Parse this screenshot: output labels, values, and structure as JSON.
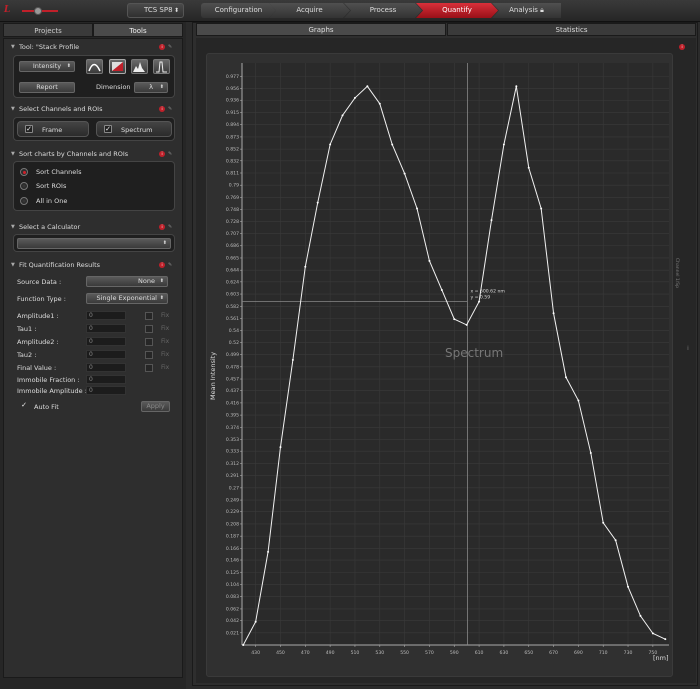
{
  "header": {
    "system_name": "TCS SP8",
    "workflow": [
      "Configuration",
      "Acquire",
      "Process",
      "Quantify",
      "Analysis"
    ],
    "active_step": "Quantify"
  },
  "left_panel": {
    "tabs": [
      "Projects",
      "Tools"
    ],
    "active_tab": "Tools",
    "tool_section": {
      "title": "Tool: \"Stack Profile",
      "mode_select": "Intensity",
      "report_button": "Report",
      "dimension_label": "Dimension",
      "dimension_value": "λ"
    },
    "channels_section": {
      "title": "Select Channels and ROIs",
      "frame_label": "Frame",
      "spectrum_label": "Spectrum"
    },
    "sort_section": {
      "title": "Sort charts by Channels and ROIs",
      "options": [
        "Sort Channels",
        "Sort ROIs",
        "All in One"
      ],
      "selected": "Sort Channels"
    },
    "calculator_section": {
      "title": "Select a Calculator"
    },
    "fit_section": {
      "title": "Fit Quantification Results",
      "source_label": "Source Data :",
      "source_value": "None",
      "function_label": "Function Type :",
      "function_value": "Single Exponential",
      "fields": [
        {
          "label": "Amplitude1 :",
          "value": "0",
          "fix": "Fix"
        },
        {
          "label": "Tau1 :",
          "value": "0",
          "fix": "Fix"
        },
        {
          "label": "Amplitude2 :",
          "value": "0",
          "fix": "Fix"
        },
        {
          "label": "Tau2 :",
          "value": "0",
          "fix": "Fix"
        },
        {
          "label": "Final Value :",
          "value": "0",
          "fix": "Fix"
        },
        {
          "label": "Immobile Fraction :",
          "value": "0",
          "fix": ""
        },
        {
          "label": "Immobile Amplitude :",
          "value": "0",
          "fix": ""
        }
      ],
      "autofit_label": "Auto Fit",
      "apply_button": "Apply"
    }
  },
  "right_panel": {
    "tabs": [
      "Graphs",
      "Statistics"
    ],
    "active_tab": "Graphs"
  },
  "chart_data": {
    "type": "line",
    "title": "",
    "watermark": "Spectrum",
    "xlabel": "[nm]",
    "ylabel": "Mean Intensity",
    "right_label": "Channel 1/Sp",
    "xlim": [
      419,
      763
    ],
    "ylim": [
      0,
      1
    ],
    "x_ticks": [
      430,
      450,
      470,
      490,
      510,
      530,
      550,
      570,
      590,
      610,
      630,
      650,
      670,
      690,
      710,
      730,
      750
    ],
    "y_ticks": [
      0.021,
      0.042,
      0.062,
      0.083,
      0.104,
      0.125,
      0.146,
      0.166,
      0.187,
      0.208,
      0.229,
      0.249,
      0.27,
      0.291,
      0.312,
      0.333,
      0.353,
      0.374,
      0.395,
      0.416,
      0.437,
      0.457,
      0.478,
      0.499,
      0.52,
      0.54,
      0.561,
      0.582,
      0.603,
      0.624,
      0.644,
      0.665,
      0.686,
      0.707,
      0.728,
      0.748,
      0.769,
      0.79,
      0.811,
      0.832,
      0.852,
      0.873,
      0.894,
      0.915,
      0.936,
      0.956,
      0.977
    ],
    "grid": true,
    "series": [
      {
        "x": [
          420,
          430,
          440,
          450,
          460,
          470,
          480,
          490,
          500,
          510,
          520,
          530,
          540,
          550,
          560,
          570,
          580,
          590,
          600,
          610,
          620,
          630,
          640,
          650,
          660,
          670,
          680,
          690,
          700,
          710,
          720,
          730,
          740,
          750,
          760
        ],
        "y": [
          0.0,
          0.04,
          0.16,
          0.34,
          0.49,
          0.65,
          0.76,
          0.86,
          0.91,
          0.94,
          0.96,
          0.93,
          0.86,
          0.81,
          0.75,
          0.66,
          0.61,
          0.56,
          0.55,
          0.59,
          0.73,
          0.86,
          0.96,
          0.82,
          0.75,
          0.57,
          0.46,
          0.42,
          0.33,
          0.21,
          0.18,
          0.1,
          0.05,
          0.02,
          0.01
        ]
      }
    ],
    "cursor": {
      "x": 600.62,
      "y": 0.59,
      "label_x": "x = 600.62 nm",
      "label_y": "y = 0.59"
    }
  }
}
